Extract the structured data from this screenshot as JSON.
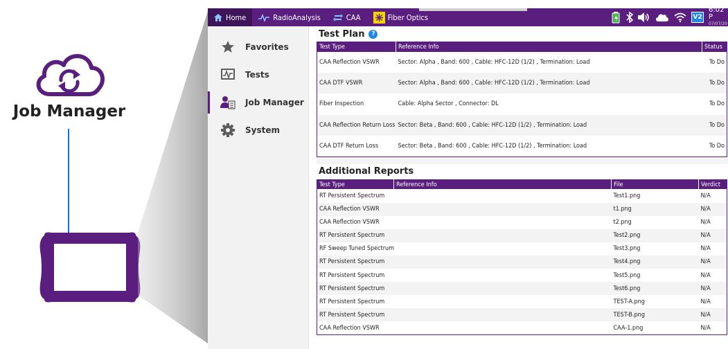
{
  "illustration": {
    "caption": "Job Manager",
    "colors": {
      "purple": "#5a1f7e",
      "connector": "#1a73c8"
    }
  },
  "topbar": {
    "tabs": [
      {
        "label": "Home",
        "icon": "home-icon",
        "active": true
      },
      {
        "label": "RadioAnalysis",
        "icon": "pulse-icon",
        "active": false
      },
      {
        "label": "CAA",
        "icon": "cable-icon",
        "active": false
      },
      {
        "label": "Fiber Optics",
        "icon": "fiber-optics-icon",
        "active": false
      }
    ],
    "status": {
      "icons": [
        "battery-icon",
        "bluetooth-icon",
        "speaker-icon",
        "cloud-icon",
        "wifi-icon"
      ],
      "badge": "V2",
      "time": "6:02 P",
      "date": "07/07/20"
    },
    "colors": {
      "bar": "#5a1f7e",
      "active_tab": "#3e1559",
      "fiber_icon_bg": "#f4d400"
    }
  },
  "sidebar": {
    "items": [
      {
        "label": "Favorites",
        "icon": "star-icon"
      },
      {
        "label": "Tests",
        "icon": "tests-icon"
      },
      {
        "label": "Job Manager",
        "icon": "job-manager-icon"
      },
      {
        "label": "System",
        "icon": "gear-icon"
      }
    ],
    "active_index": 2
  },
  "test_plan": {
    "title": "Test Plan",
    "columns": [
      "Test Type",
      "Reference Info",
      "Status"
    ],
    "rows": [
      [
        "CAA Reflection VSWR",
        "Sector: Alpha , Band: 600 , Cable: HFC-12D (1/2) , Termination: Load",
        "To Do"
      ],
      [
        "CAA DTF VSWR",
        "Sector: Alpha , Band: 600 , Cable: HFC-12D (1/2) , Termination: Load",
        "To Do"
      ],
      [
        "Fiber Inspection",
        "Cable: Alpha Sector , Connector: DL",
        "To Do"
      ],
      [
        "CAA Reflection Return Loss",
        "Sector: Beta , Band: 600 , Cable: HFC-12D (1/2) , Termination: Load",
        "To Do"
      ],
      [
        "CAA DTF Return Loss",
        "Sector: Beta , Band: 600 , Cable: HFC-12D (1/2) , Termination: Load",
        "To Do"
      ]
    ]
  },
  "additional_reports": {
    "title": "Additional Reports",
    "columns": [
      "Test Type",
      "Reference Info",
      "File",
      "Verdict"
    ],
    "rows": [
      [
        "RT Persistent Spectrum",
        "",
        "Test1.png",
        "N/A"
      ],
      [
        "CAA Reflection VSWR",
        "",
        "t1.png",
        "N/A"
      ],
      [
        "CAA Reflection VSWR",
        "",
        "t2.png",
        "N/A"
      ],
      [
        "RT Persistent Spectrum",
        "",
        "Test2.png",
        "N/A"
      ],
      [
        "RF Sweep Tuned Spectrum",
        "",
        "Test3.png",
        "N/A"
      ],
      [
        "RT Persistent Spectrum",
        "",
        "Test4.png",
        "N/A"
      ],
      [
        "RT Persistent Spectrum",
        "",
        "Test5.png",
        "N/A"
      ],
      [
        "RT Persistent Spectrum",
        "",
        "Test6.png",
        "N/A"
      ],
      [
        "RT Persistent Spectrum",
        "",
        "TEST-A.png",
        "N/A"
      ],
      [
        "RT Persistent Spectrum",
        "",
        "TEST-B.png",
        "N/A"
      ],
      [
        "CAA Reflection VSWR",
        "",
        "CAA-1.png",
        "N/A"
      ]
    ]
  }
}
